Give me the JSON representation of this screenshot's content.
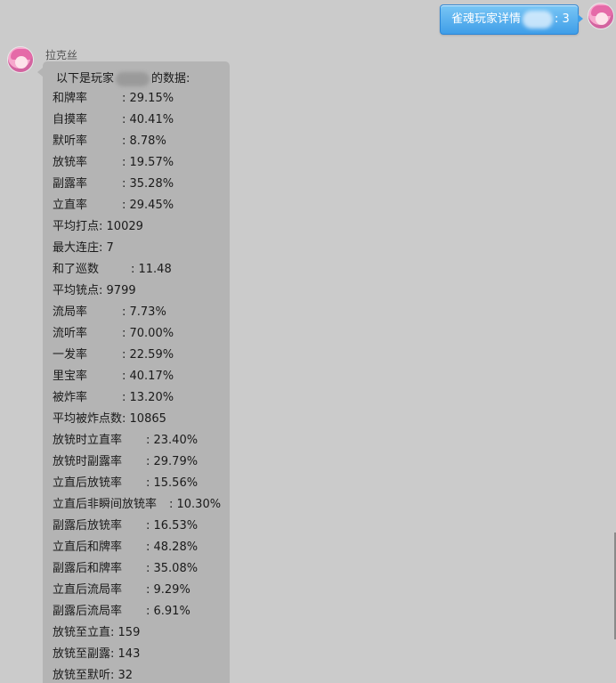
{
  "outgoing": {
    "before": "雀魂玩家详情",
    "after": ": 3"
  },
  "incoming": {
    "sender": "拉克丝",
    "intro_before": "以下是玩家",
    "intro_after": "的数据:"
  },
  "stats": [
    {
      "label": "和牌率",
      "value": ": 29.15%"
    },
    {
      "label": "自摸率",
      "value": ": 40.41%"
    },
    {
      "label": "默听率",
      "value": ": 8.78%"
    },
    {
      "label": "放铳率",
      "value": ": 19.57%"
    },
    {
      "label": "副露率",
      "value": ": 35.28%"
    },
    {
      "label": "立直率",
      "value": ": 29.45%"
    },
    {
      "label": "平均打点",
      "value": ": 10029"
    },
    {
      "label": "最大连庄",
      "value": ": 7"
    },
    {
      "label": "和了巡数",
      "value": ": 11.48"
    },
    {
      "label": "平均铳点",
      "value": ": 9799"
    },
    {
      "label": "流局率",
      "value": ": 7.73%"
    },
    {
      "label": "流听率",
      "value": ": 70.00%"
    },
    {
      "label": "一发率",
      "value": ": 22.59%"
    },
    {
      "label": "里宝率",
      "value": ": 40.17%"
    },
    {
      "label": "被炸率",
      "value": ": 13.20%"
    },
    {
      "label": "平均被炸点数",
      "value": ": 10865"
    },
    {
      "label": "放铳时立直率",
      "value": ": 23.40%"
    },
    {
      "label": "放铳时副露率",
      "value": ": 29.79%"
    },
    {
      "label": "立直后放铳率",
      "value": ": 15.56%"
    },
    {
      "label": "立直后非瞬间放铳率",
      "value": ": 10.30%"
    },
    {
      "label": "副露后放铳率",
      "value": ": 16.53%"
    },
    {
      "label": "立直后和牌率",
      "value": ": 48.28%"
    },
    {
      "label": "副露后和牌率",
      "value": ": 35.08%"
    },
    {
      "label": "立直后流局率",
      "value": ": 9.29%"
    },
    {
      "label": "副露后流局率",
      "value": ": 6.91%"
    },
    {
      "label": "放铳至立直",
      "value": ": 159"
    },
    {
      "label": "放铳至副露",
      "value": ": 143"
    },
    {
      "label": "放铳至默听",
      "value": ": 32"
    }
  ]
}
